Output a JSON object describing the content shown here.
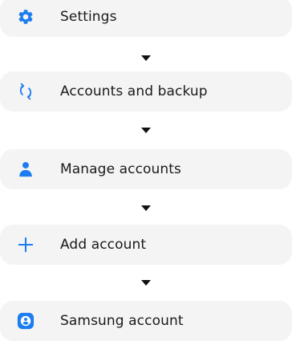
{
  "accent_color": "#1c7cf0",
  "steps": [
    {
      "label": "Settings",
      "icon": "gear-icon"
    },
    {
      "label": "Accounts and backup",
      "icon": "sync-icon"
    },
    {
      "label": "Manage accounts",
      "icon": "person-icon"
    },
    {
      "label": "Add account",
      "icon": "plus-icon"
    },
    {
      "label": "Samsung account",
      "icon": "samsung-account-icon"
    }
  ]
}
